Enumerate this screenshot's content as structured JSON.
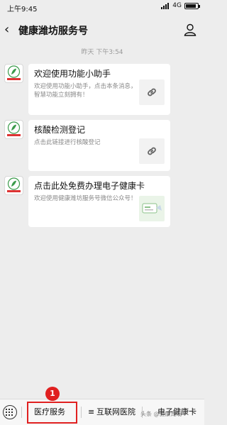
{
  "statusbar": {
    "time": "上午9:45",
    "network": "4G",
    "battery_level": 0.85
  },
  "navbar": {
    "title": "健康潍坊服务号"
  },
  "chat": {
    "timestamp": "昨天 下午3:54",
    "messages": [
      {
        "title": "欢迎使用功能小助手",
        "desc": "欢迎使用功能小助手，点击本条消息，智慧功能立刻拥有！",
        "thumb": "link-icon"
      },
      {
        "title": "核酸检测登记",
        "desc": "点击此链接进行核酸登记",
        "thumb": "link-icon"
      },
      {
        "title": "点击此处免费办理电子健康卡",
        "desc": "欢迎使用健康潍坊服务号微信公众号！",
        "thumb": "health-card-image"
      }
    ],
    "avatar_label": "健康潍坊"
  },
  "bottom_menu": {
    "items": [
      {
        "label": "医疗服务"
      },
      {
        "label": "互联网医院"
      },
      {
        "label": "电子健康卡"
      }
    ]
  },
  "annotation": {
    "step_number": "1",
    "color": "#e02020"
  },
  "watermark": "头条 @健康潍坊"
}
